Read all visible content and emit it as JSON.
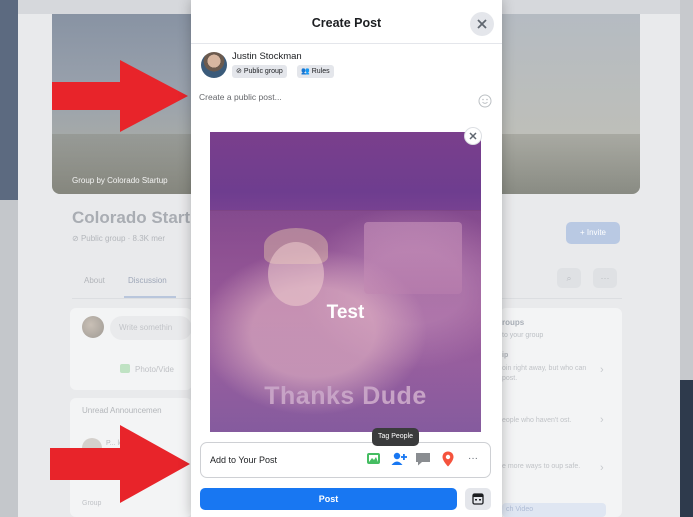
{
  "background": {
    "cover_credit": "Group by Colorado Startup",
    "group_name": "Colorado Start",
    "group_meta": "Public group · 8.3K mer",
    "invite_label": "+ Invite",
    "tabs": [
      {
        "label": "About"
      },
      {
        "label": "Discussion"
      }
    ],
    "search_glyph": "⌕",
    "more_glyph": "···",
    "composer": {
      "placeholder": "Write somethin",
      "photo_label": "Photo/Vide"
    },
    "announcements": {
      "title": "Unread Announcemen",
      "author": "P... ley is",
      "groups_label": "Group"
    },
    "side": {
      "title": "roups",
      "subtitle": "to your group",
      "heading": "ip",
      "text1": "oin right away, but who can post.",
      "text2": "eople who haven't ost.",
      "text3": "e more ways to oup safe.",
      "link": "ch Video"
    }
  },
  "modal": {
    "title": "Create Post",
    "user": {
      "name": "Justin Stockman",
      "privacy_chip": "Public group",
      "rules_chip": "Rules"
    },
    "post_placeholder": "Create a public post...",
    "media": {
      "overlay_text": "Test",
      "caption": "Thanks Dude"
    },
    "tooltip": "Tag People",
    "add_to_post_label": "Add to Your Post",
    "more_glyph": "···",
    "post_button": "Post"
  },
  "colors": {
    "accent": "#1877f2",
    "arrow": "#e8242a",
    "photo_icon": "#45bd62",
    "tag_icon": "#1877f2",
    "location_icon": "#f5533d",
    "feeling_icon": "#8a8d91"
  },
  "icons": {
    "close": "close-icon",
    "globe": "globe-icon",
    "members": "members-icon",
    "emoji": "emoji-icon",
    "photo": "photo-icon",
    "tag_people": "tag-people-icon",
    "message": "message-icon",
    "location": "location-pin-icon",
    "more": "more-icon",
    "schedule": "schedule-icon"
  }
}
